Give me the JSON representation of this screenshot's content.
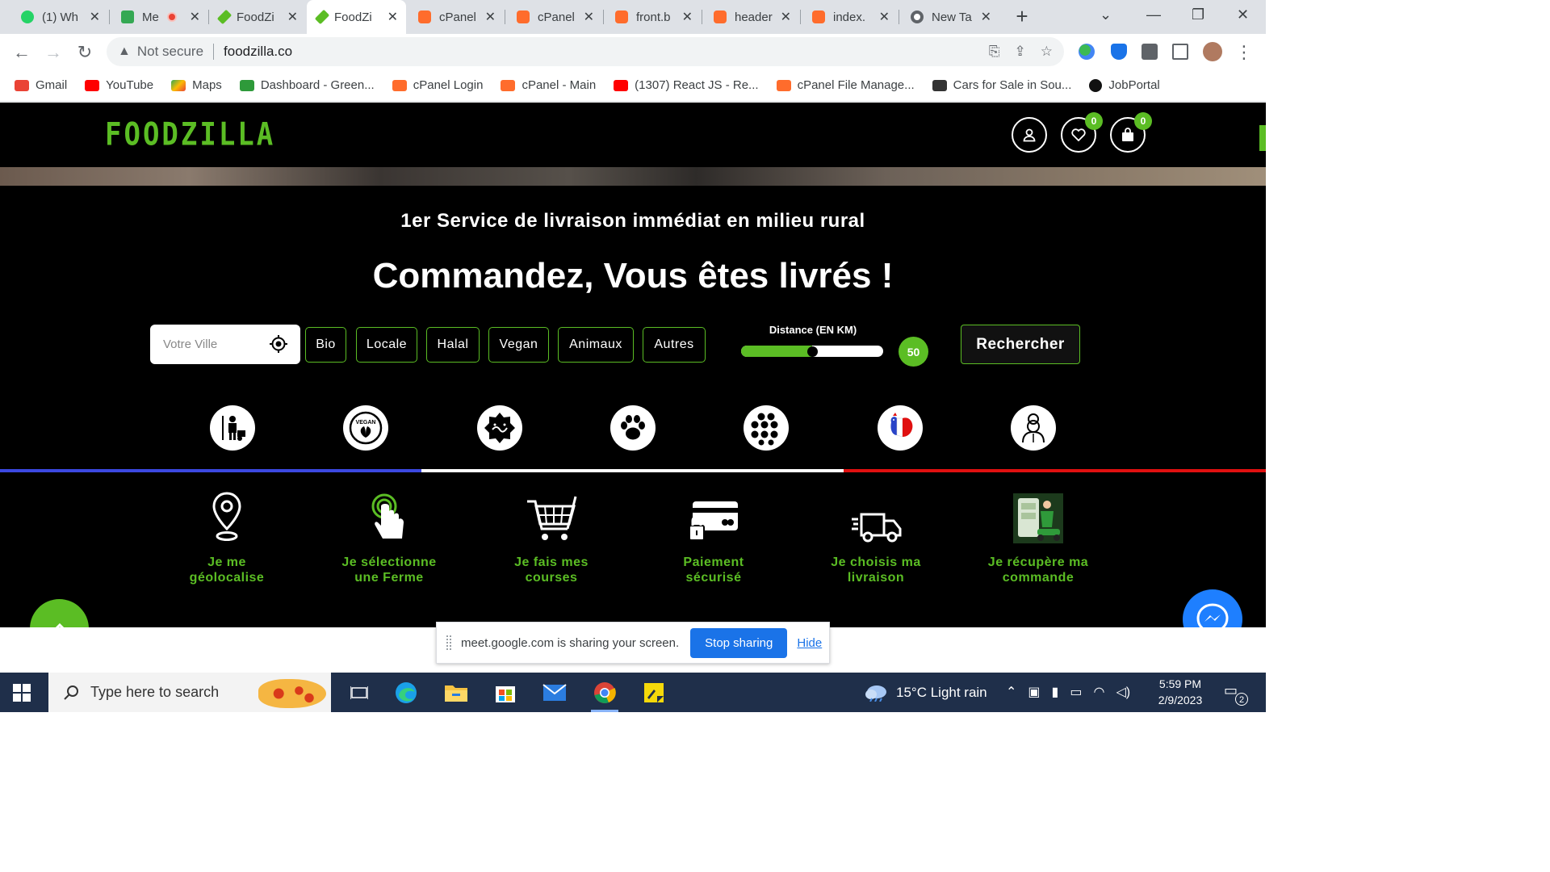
{
  "browser": {
    "tabs": [
      {
        "title": "(1) Wh",
        "color": "#25d366"
      },
      {
        "title": "Me",
        "color": "#34a853"
      },
      {
        "title": "FoodZi",
        "color": "#5bbd24"
      },
      {
        "title": "FoodZi",
        "color": "#5bbd24",
        "active": true
      },
      {
        "title": "cPanel",
        "color": "#ff6c2c"
      },
      {
        "title": "cPanel",
        "color": "#ff6c2c"
      },
      {
        "title": "front.b",
        "color": "#ff6c2c"
      },
      {
        "title": "header",
        "color": "#ff6c2c"
      },
      {
        "title": "index.",
        "color": "#ff6c2c"
      },
      {
        "title": "New Ta",
        "color": "#5f6368"
      }
    ],
    "address": {
      "security": "Not secure",
      "url": "foodzilla.co"
    },
    "bookmarks": [
      {
        "label": "Gmail",
        "color": "#ea4335"
      },
      {
        "label": "YouTube",
        "color": "#ff0000"
      },
      {
        "label": "Maps",
        "color": "#34a853"
      },
      {
        "label": "Dashboard - Green...",
        "color": "#2e9a3a"
      },
      {
        "label": "cPanel Login",
        "color": "#ff6c2c"
      },
      {
        "label": "cPanel - Main",
        "color": "#ff6c2c"
      },
      {
        "label": "(1307) React JS - Re...",
        "color": "#ff0000"
      },
      {
        "label": "cPanel File Manage...",
        "color": "#ff6c2c"
      },
      {
        "label": "Cars for Sale in Sou...",
        "color": "#333333"
      },
      {
        "label": "JobPortal",
        "color": "#111111"
      }
    ]
  },
  "site": {
    "logo": "FOODZILLA",
    "wishlist_count": "0",
    "cart_count": "0",
    "tagline": "1er Service de livraison immédiat en milieu rural",
    "headline": "Commandez, Vous êtes livrés !",
    "city_placeholder": "Votre Ville",
    "filters": [
      "Bio",
      "Locale",
      "Halal",
      "Vegan",
      "Animaux",
      "Autres"
    ],
    "distance_label": "Distance (EN KM)",
    "distance_value": "50",
    "distance_fraction": 0.5,
    "search_label": "Rechercher",
    "categories": [
      "farmer-icon",
      "vegan-icon",
      "halal-icon",
      "paw-icon",
      "grid-dots-icon",
      "rooster-icon",
      "chef-icon"
    ],
    "steps": [
      {
        "line1": "Je me",
        "line2": "géolocalise",
        "icon": "location-pin-icon"
      },
      {
        "line1": "Je sélectionne",
        "line2": "une Ferme",
        "icon": "touch-select-icon"
      },
      {
        "line1": "Je fais mes",
        "line2": "courses",
        "icon": "shopping-cart-icon"
      },
      {
        "line1": "Paiement",
        "line2": "sécurisé",
        "icon": "secure-card-icon"
      },
      {
        "line1": "Je choisis ma",
        "line2": "livraison",
        "icon": "delivery-truck-icon"
      },
      {
        "line1": "Je récupère ma",
        "line2": "commande",
        "icon": "delivery-person-icon"
      }
    ],
    "colors": {
      "accent": "#5bbd24",
      "flag_blue": "#3b48e0",
      "flag_white": "#ffffff",
      "flag_red": "#e01010"
    }
  },
  "sharing": {
    "message": "meet.google.com is sharing your screen.",
    "stop_label": "Stop sharing",
    "hide_label": "Hide"
  },
  "taskbar": {
    "search_placeholder": "Type here to search",
    "weather": "15°C  Light rain",
    "time": "5:59 PM",
    "date": "2/9/2023",
    "notifications": "2"
  }
}
